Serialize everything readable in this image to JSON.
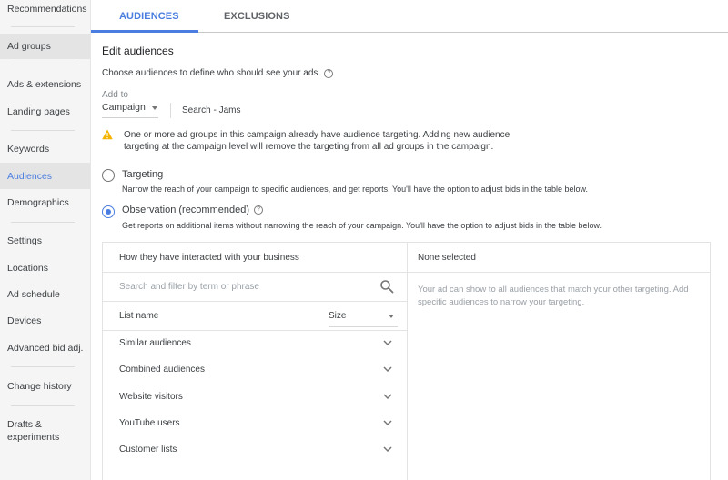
{
  "sidebar": {
    "items": [
      {
        "label": "Recommendations"
      },
      {
        "label": "Ad groups"
      },
      {
        "label": "Ads & extensions"
      },
      {
        "label": "Landing pages"
      },
      {
        "label": "Keywords"
      },
      {
        "label": "Audiences"
      },
      {
        "label": "Demographics"
      },
      {
        "label": "Settings"
      },
      {
        "label": "Locations"
      },
      {
        "label": "Ad schedule"
      },
      {
        "label": "Devices"
      },
      {
        "label": "Advanced bid adj."
      },
      {
        "label": "Change history"
      },
      {
        "label": "Drafts & experiments"
      }
    ],
    "active_item": "Audiences"
  },
  "tabs": {
    "items": [
      {
        "label": "AUDIENCES",
        "active": true
      },
      {
        "label": "EXCLUSIONS",
        "active": false
      }
    ]
  },
  "main": {
    "title": "Edit audiences",
    "subtitle": "Choose audiences to define who should see your ads",
    "help_icon_glyph": "?",
    "add_to": {
      "label": "Add to",
      "selected": "Campaign",
      "campaign_name": "Search - Jams"
    },
    "warning": {
      "icon": "warning-triangle-icon",
      "color": "#f4b400",
      "text": "One or more ad groups in this campaign already have audience targeting. Adding new audience targeting at the campaign level will remove the targeting from all ad groups in the campaign."
    },
    "options": [
      {
        "title": "Targeting",
        "description": "Narrow the reach of your campaign to specific audiences, and get reports. You'll have the option to adjust bids in the table below.",
        "checked": false
      },
      {
        "title": "Observation (recommended)",
        "description": "Get reports on additional items without narrowing the reach of your campaign. You'll have the option to adjust bids in the table below.",
        "checked": true
      }
    ]
  },
  "browse_panel": {
    "header": "How they have interacted with your business",
    "search_placeholder": "Search and filter by term or phrase",
    "column_list_name": "List name",
    "column_size": "Size",
    "categories": [
      {
        "label": "Similar audiences"
      },
      {
        "label": "Combined audiences"
      },
      {
        "label": "Website visitors"
      },
      {
        "label": "YouTube users"
      },
      {
        "label": "Customer lists"
      }
    ]
  },
  "selected_panel": {
    "header": "None selected",
    "description": "Your ad can show to all audiences that match your other targeting. Add specific audiences to narrow your targeting."
  },
  "colors": {
    "accent": "#4a7de0",
    "warning": "#f4b400",
    "sidebar_bg": "#f5f5f5",
    "sidebar_selected_bg": "#e4e4e4"
  }
}
